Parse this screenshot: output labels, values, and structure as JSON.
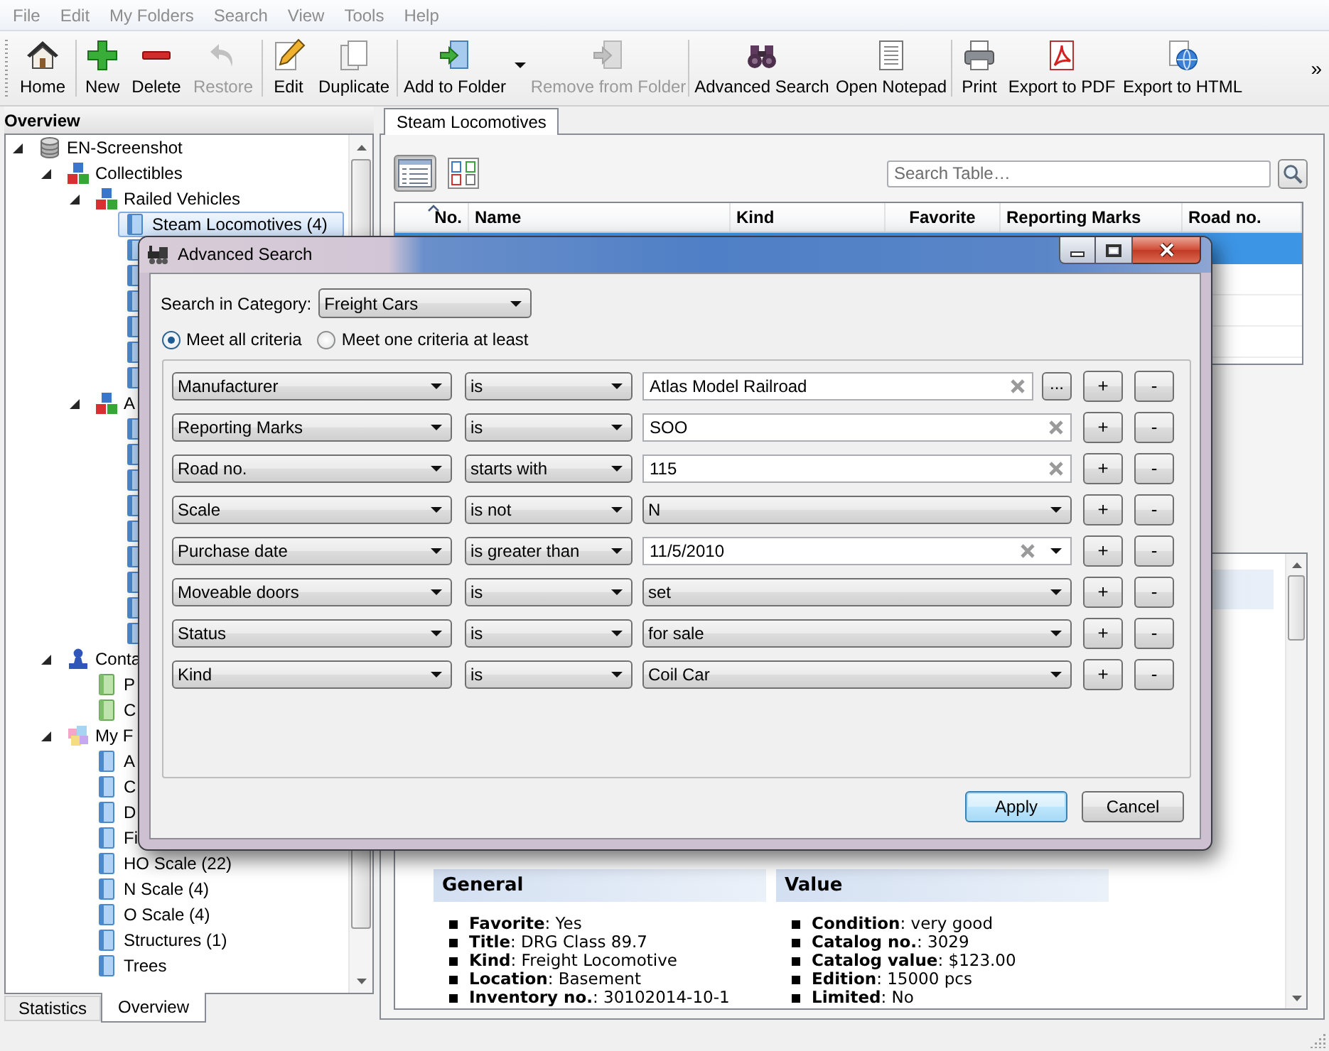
{
  "menu_bar": [
    {
      "label": "File",
      "disabled": true
    },
    {
      "label": "Edit",
      "disabled": true
    },
    {
      "label": "My Folders",
      "disabled": true
    },
    {
      "label": "Search",
      "disabled": true
    },
    {
      "label": "View",
      "disabled": true
    },
    {
      "label": "Tools",
      "disabled": true
    },
    {
      "label": "Help",
      "disabled": true
    }
  ],
  "toolbar": {
    "groups": [
      {
        "buttons": [
          {
            "label": "Home",
            "disabled": false
          }
        ]
      },
      {
        "buttons": [
          {
            "label": "New",
            "disabled": false
          },
          {
            "label": "Delete",
            "disabled": false
          },
          {
            "label": "Restore",
            "disabled": true
          }
        ]
      },
      {
        "buttons": [
          {
            "label": "Edit",
            "disabled": false
          },
          {
            "label": "Duplicate",
            "disabled": false
          }
        ]
      },
      {
        "buttons": [
          {
            "label": "Add to Folder",
            "disabled": false,
            "menu": true
          },
          {
            "label": "Remove from Folder",
            "disabled": true
          }
        ]
      },
      {
        "buttons": [
          {
            "label": "Advanced Search",
            "disabled": false
          },
          {
            "label": "Open Notepad",
            "disabled": false
          }
        ]
      },
      {
        "buttons": [
          {
            "label": "Print",
            "disabled": false
          },
          {
            "label": "Export to PDF",
            "disabled": false
          },
          {
            "label": "Export to HTML",
            "disabled": false
          }
        ]
      }
    ],
    "overflow": "»"
  },
  "sidebar": {
    "title": "Overview",
    "tree": [
      {
        "label": "EN-Screenshot",
        "kind": "database",
        "expanded": true,
        "selected": false,
        "children": [
          {
            "label": "Collectibles",
            "kind": "category",
            "expanded": true,
            "selected": false,
            "children": [
              {
                "label": "Railed Vehicles",
                "kind": "category",
                "expanded": true,
                "selected": false,
                "children": [
                  {
                    "label": "Steam Locomotives (4)",
                    "kind": "folder",
                    "selected": true
                  },
                  {
                    "kind": "folder"
                  },
                  {
                    "kind": "folder"
                  },
                  {
                    "kind": "folder"
                  },
                  {
                    "kind": "folder"
                  },
                  {
                    "kind": "folder"
                  },
                  {
                    "kind": "folder"
                  }
                ]
              },
              {
                "label": "A",
                "kind": "category",
                "expanded": true,
                "selected": false,
                "children": [
                  {
                    "kind": "folder"
                  },
                  {
                    "kind": "folder"
                  },
                  {
                    "kind": "folder"
                  },
                  {
                    "kind": "folder"
                  },
                  {
                    "kind": "folder"
                  },
                  {
                    "kind": "folder"
                  },
                  {
                    "kind": "folder"
                  },
                  {
                    "kind": "folder"
                  },
                  {
                    "kind": "folder"
                  }
                ]
              }
            ]
          },
          {
            "label": "Conta",
            "kind": "contacts",
            "expanded": true,
            "selected": false,
            "children": [
              {
                "label": "P",
                "kind": "contact_group",
                "selected": false
              },
              {
                "label": "C",
                "kind": "contact_group",
                "selected": false
              }
            ]
          },
          {
            "label": "My F",
            "kind": "folders",
            "expanded": true,
            "selected": false,
            "children": [
              {
                "label": "A",
                "kind": "folder",
                "selected": false
              },
              {
                "label": "C",
                "kind": "folder",
                "selected": false
              },
              {
                "label": "D",
                "kind": "folder",
                "selected": false
              },
              {
                "label": "Fi",
                "kind": "folder",
                "selected": false
              },
              {
                "label": "HO Scale (22)",
                "kind": "folder",
                "selected": false
              },
              {
                "label": "N Scale (4)",
                "kind": "folder",
                "selected": false
              },
              {
                "label": "O Scale (4)",
                "kind": "folder",
                "selected": false
              },
              {
                "label": "Structures (1)",
                "kind": "folder",
                "selected": false
              },
              {
                "label": "Trees",
                "kind": "folder",
                "selected": false
              }
            ]
          }
        ]
      }
    ],
    "tabs": [
      {
        "label": "Statistics",
        "selected": false
      },
      {
        "label": "Overview",
        "selected": true
      }
    ]
  },
  "content": {
    "tabs": [
      {
        "label": "Steam Locomotives",
        "selected": true
      }
    ],
    "view_buttons": [
      {
        "kind": "list",
        "selected": true
      },
      {
        "kind": "gallery",
        "selected": false
      }
    ],
    "search": {
      "placeholder": "Search Table…"
    },
    "table": {
      "columns": [
        {
          "label": "No.",
          "sorted_ascending": true
        },
        {
          "label": "Name"
        },
        {
          "label": "Kind"
        },
        {
          "label": "Favorite"
        },
        {
          "label": "Reporting Marks"
        },
        {
          "label": "Road no."
        }
      ],
      "rows": [
        {
          "selected": true
        },
        {
          "selected": false
        },
        {
          "selected": false
        },
        {
          "selected": false
        }
      ]
    },
    "details": {
      "sections": [
        {
          "title": "General",
          "items": [
            "**Favorite**: Yes",
            "**Title**: DRG Class 89.7",
            "**Kind**: Freight Locomotive",
            "**Location**: Basement",
            "**Inventory no.**: 30102014-10-1"
          ]
        },
        {
          "title": "Value",
          "items": [
            "**Condition**: very good",
            "**Catalog no.**: 3029",
            "**Catalog value**: $123.00",
            "**Edition**: 15000 pcs",
            "**Limited**: No"
          ]
        }
      ]
    }
  },
  "dialog": {
    "title": "Advanced Search",
    "category": {
      "label": "Search in Category:",
      "value": "Freight Cars"
    },
    "match_options": [
      {
        "label": "Meet all criteria",
        "selected": true
      },
      {
        "label": "Meet one criteria at least",
        "selected": false
      }
    ],
    "criteria": [
      {
        "field": "Manufacturer",
        "operator": "is",
        "kind": "text",
        "value": "Atlas Model Railroad",
        "browse": "...",
        "add": "+",
        "remove": "-"
      },
      {
        "field": "Reporting Marks",
        "operator": "is",
        "kind": "text",
        "value": "SOO",
        "add": "+",
        "remove": "-"
      },
      {
        "field": "Road no.",
        "operator": "starts with",
        "kind": "text",
        "value": "115",
        "add": "+",
        "remove": "-"
      },
      {
        "field": "Scale",
        "operator": "is not",
        "kind": "choice",
        "value": "N",
        "add": "+",
        "remove": "-"
      },
      {
        "field": "Purchase date",
        "operator": "is greater than",
        "kind": "date",
        "value": "11/5/2010",
        "add": "+",
        "remove": "-"
      },
      {
        "field": "Moveable doors",
        "operator": "is",
        "kind": "choice",
        "value": "set",
        "add": "+",
        "remove": "-"
      },
      {
        "field": "Status",
        "operator": "is",
        "kind": "choice",
        "value": "for sale",
        "add": "+",
        "remove": "-"
      },
      {
        "field": "Kind",
        "operator": "is",
        "kind": "choice",
        "value": "Coil Car",
        "add": "+",
        "remove": "-"
      }
    ],
    "buttons": [
      {
        "label": "Apply",
        "default": true
      },
      {
        "label": "Cancel",
        "default": false
      }
    ]
  }
}
